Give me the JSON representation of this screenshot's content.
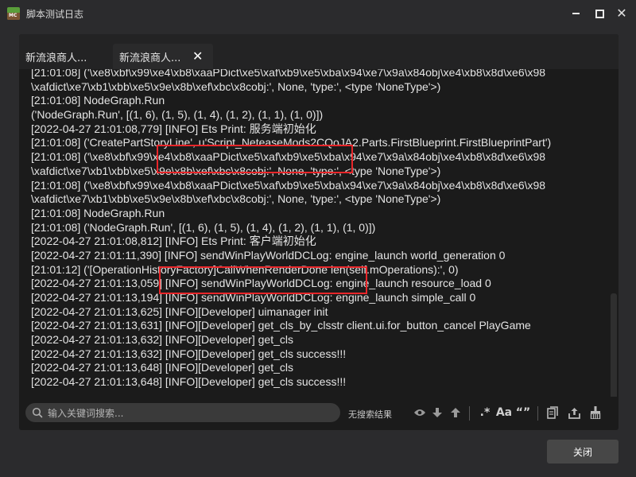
{
  "window": {
    "title": "脚本测试日志",
    "icon_text": "MC"
  },
  "tabs": [
    {
      "label": "新流浪商人..."
    },
    {
      "label": "新流浪商人..."
    }
  ],
  "log": {
    "lines": [
      "[21:01:08] ('\\xe8\\xbf\\x99\\xe4\\xb8\\xaaPDict\\xe5\\xaf\\xb9\\xe5\\xba\\x94\\xe7\\x9a\\x84obj\\xe4\\xb8\\x8d\\xe6\\x98",
      "\\xafdict\\xe7\\xb1\\xbb\\xe5\\x9e\\x8b\\xef\\xbc\\x8cobj:', None, 'type:', <type 'NoneType'>)",
      "[21:01:08] NodeGraph.Run",
      "('NodeGraph.Run', [(1, 6), (1, 5), (1, 4), (1, 2), (1, 1), (1, 0)])",
      "[2022-04-27 21:01:08,779] [INFO] Ets Print: 服务端初始化",
      "[21:01:08] ('CreatePartStoryLine', u'Script_NeteaseMods2CQoJA2.Parts.FirstBlueprint.FirstBlueprintPart')",
      "[21:01:08] ('\\xe8\\xbf\\x99\\xe4\\xb8\\xaaPDict\\xe5\\xaf\\xb9\\xe5\\xba\\x94\\xe7\\x9a\\x84obj\\xe4\\xb8\\x8d\\xe6\\x98",
      "\\xafdict\\xe7\\xb1\\xbb\\xe5\\x9e\\x8b\\xef\\xbc\\x8cobj:', None, 'type:', <type 'NoneType'>)",
      "[21:01:08] ('\\xe8\\xbf\\x99\\xe4\\xb8\\xaaPDict\\xe5\\xaf\\xb9\\xe5\\xba\\x94\\xe7\\x9a\\x84obj\\xe4\\xb8\\x8d\\xe6\\x98",
      "\\xafdict\\xe7\\xb1\\xbb\\xe5\\x9e\\x8b\\xef\\xbc\\x8cobj:', None, 'type:', <type 'NoneType'>)",
      "[21:01:08] NodeGraph.Run",
      "[21:01:08] ('NodeGraph.Run', [(1, 6), (1, 5), (1, 4), (1, 2), (1, 1), (1, 0)])",
      "[2022-04-27 21:01:08,812] [INFO] Ets Print: 客户端初始化",
      "[2022-04-27 21:01:11,390] [INFO] sendWinPlayWorldDCLog: engine_launch world_generation 0",
      "[21:01:12] ('[OperationHistoryFactory]CallWhenRenderDone len(self.mOperations):', 0)",
      "[2022-04-27 21:01:13,059] [INFO] sendWinPlayWorldDCLog: engine_launch resource_load 0",
      "[2022-04-27 21:01:13,194] [INFO] sendWinPlayWorldDCLog: engine_launch simple_call 0",
      "[2022-04-27 21:01:13,625] [INFO][Developer] uimanager init",
      "[2022-04-27 21:01:13,631] [INFO][Developer] get_cls_by_clsstr client.ui.for_button_cancel PlayGame",
      "[2022-04-27 21:01:13,632] [INFO][Developer] get_cls",
      "[2022-04-27 21:01:13,632] [INFO][Developer] get_cls success!!!",
      "[2022-04-27 21:01:13,648] [INFO][Developer] get_cls",
      "[2022-04-27 21:01:13,648] [INFO][Developer] get_cls success!!!"
    ]
  },
  "search": {
    "placeholder": "输入关键词搜索...",
    "value": "",
    "status": "无搜索结果"
  },
  "toolbar": {
    "regex_label": ".*",
    "case_label": "Aa",
    "word_label": "“”",
    "icons": [
      "eye-icon",
      "arrow-down-icon",
      "arrow-up-icon",
      "regex-icon",
      "match-case-icon",
      "whole-word-icon",
      "copy-icon",
      "export-icon",
      "clear-icon"
    ]
  },
  "footer": {
    "close_label": "关闭"
  },
  "colors": {
    "background": "#2b2b2d",
    "log_background": "#1b1b1b",
    "highlight": "#e8262a",
    "button": "#474747"
  }
}
